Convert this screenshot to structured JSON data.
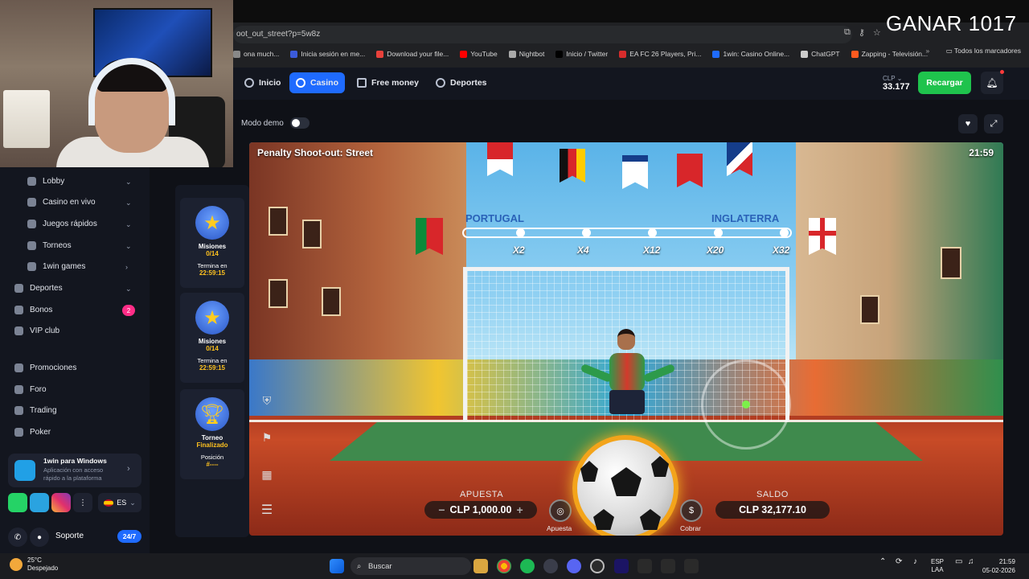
{
  "overlay": {
    "ganar": "GANAR 1017"
  },
  "browser": {
    "url": "oot_out_street?p=5w8z",
    "bookmarks": [
      {
        "label": "ona much...",
        "color": "#888"
      },
      {
        "label": "Inicia sesión en me...",
        "color": "#3b5bdb"
      },
      {
        "label": "Download your file...",
        "color": "#e8413b"
      },
      {
        "label": "YouTube",
        "color": "#ff0000"
      },
      {
        "label": "Nightbot",
        "color": "#aaaaaa"
      },
      {
        "label": "Inicio / Twitter",
        "color": "#000000"
      },
      {
        "label": "EA FC 26 Players, Pri...",
        "color": "#d72c2c"
      },
      {
        "label": "1win: Casino Online...",
        "color": "#1f6bff"
      },
      {
        "label": "ChatGPT",
        "color": "#cccccc"
      },
      {
        "label": "Zapping - Televisión...",
        "color": "#ff5a1f"
      }
    ],
    "more": "»",
    "all_bookmarks": "Todos los marcadores"
  },
  "header": {
    "nav": [
      {
        "label": "Inicio",
        "icon": "home-icon"
      },
      {
        "label": "Casino",
        "icon": "casino-icon"
      },
      {
        "label": "Free money",
        "icon": "gift-icon"
      },
      {
        "label": "Deportes",
        "icon": "ball-icon"
      }
    ],
    "currency": "CLP ⌄",
    "balance": "33.177",
    "recargar": "Recargar"
  },
  "demo": {
    "label": "Modo demo"
  },
  "sidebar": {
    "items": [
      {
        "label": "Lobby",
        "icon": "grid-icon",
        "chevron": "⌄"
      },
      {
        "label": "Casino en vivo",
        "icon": "live-icon",
        "chevron": "⌄"
      },
      {
        "label": "Juegos rápidos",
        "icon": "flash-icon",
        "chevron": "⌄"
      },
      {
        "label": "Torneos",
        "icon": "shield-icon",
        "chevron": "⌄"
      },
      {
        "label": "1win games",
        "icon": "brand-icon",
        "chevron": "›"
      },
      {
        "label": "Deportes",
        "icon": "ball-icon",
        "chevron": "⌄"
      },
      {
        "label": "Bonos",
        "icon": "gift-icon",
        "badge": "2"
      },
      {
        "label": "VIP club",
        "icon": "crown-icon"
      },
      {
        "label": "Promociones",
        "icon": "promo-icon"
      },
      {
        "label": "Foro",
        "icon": "chat-icon"
      },
      {
        "label": "Trading",
        "icon": "chart-icon"
      },
      {
        "label": "Poker",
        "icon": "poker-icon"
      }
    ],
    "app_box": {
      "title": "1win para Windows",
      "subtitle": "Aplicación con acceso rápido a la plataforma"
    },
    "lang": "ES",
    "support": "Soporte",
    "support_badge": "24/7"
  },
  "missions": [
    {
      "title": "Misiones",
      "progress": "0/14",
      "label2": "Termina en",
      "time": "22:59:15"
    },
    {
      "title": "Misiones",
      "progress": "0/14",
      "label2": "Termina en",
      "time": "22:59:15"
    },
    {
      "title": "Torneo",
      "progress": "Finalizado",
      "label2": "Posición",
      "time": "#----"
    }
  ],
  "game": {
    "title": "Penalty Shoot-out: Street",
    "time": "21:59",
    "team_left": "PORTUGAL",
    "team_right": "INGLATERRA",
    "multipliers": [
      "X2",
      "X4",
      "X12",
      "X20",
      "X32"
    ],
    "bet_label": "APUESTA",
    "bet_value": "CLP 1,000.00",
    "bet_minus": "−",
    "bet_plus": "+",
    "balance_label": "SALDO",
    "balance_value": "CLP 32,177.10",
    "apuesta_btn": "Apuesta",
    "cobrar_btn": "Cobrar"
  },
  "taskbar": {
    "temp": "25°C",
    "weather": "Despejado",
    "search": "Buscar",
    "lang1": "ESP",
    "lang2": "LAA",
    "time": "21:59",
    "date": "05-02-2026"
  }
}
